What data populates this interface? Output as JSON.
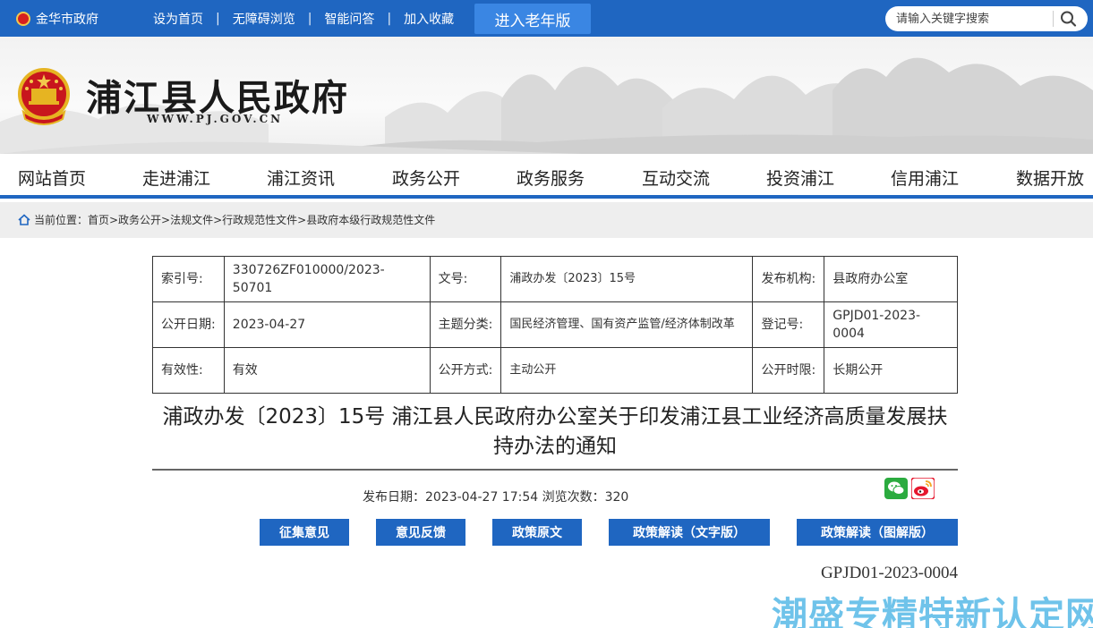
{
  "topbar": {
    "city": "金华市政府",
    "links": [
      "设为首页",
      "无障碍浏览",
      "智能问答",
      "加入收藏"
    ],
    "elder_mode": "进入老年版",
    "search_placeholder": "请输入关键字搜索"
  },
  "banner": {
    "site_name": "浦江县人民政府",
    "site_url": "WWW.PJ.GOV.CN"
  },
  "nav": [
    "网站首页",
    "走进浦江",
    "浦江资讯",
    "政务公开",
    "政务服务",
    "互动交流",
    "投资浦江",
    "信用浦江",
    "数据开放"
  ],
  "breadcrumb": "当前位置：首页>政务公开>法规文件>行政规范性文件>县政府本级行政规范性文件",
  "meta": {
    "index_label": "索引号:",
    "index_value": "330726ZF010000/2023-50701",
    "docno_label": "文号:",
    "docno_value": "浦政办发〔2023〕15号",
    "issuer_label": "发布机构:",
    "issuer_value": "县政府办公室",
    "pubdate_label": "公开日期:",
    "pubdate_value": "2023-04-27",
    "topic_label": "主题分类:",
    "topic_value": "国民经济管理、国有资产监管/经济体制改革",
    "regno_label": "登记号:",
    "regno_value": "GPJD01-2023-0004",
    "valid_label": "有效性:",
    "valid_value": "有效",
    "method_label": "公开方式:",
    "method_value": "主动公开",
    "term_label": "公开时限:",
    "term_value": "长期公开"
  },
  "doc_title": "浦政办发〔2023〕15号 浦江县人民政府办公室关于印发浦江县工业经济高质量发展扶持办法的通知",
  "pub_info": "发布日期：2023-04-27 17:54    浏览次数：320",
  "buttons": [
    "征集意见",
    "意见反馈",
    "政策原文",
    "政策解读（文字版）",
    "政策解读（图解版）"
  ],
  "reg_code": "GPJD01-2023-0004",
  "watermark": "潮盛专精特新认定网",
  "colors": {
    "primary": "#1f66c1",
    "elder_button": "#3a86e3",
    "watermark": "#6fc3ea"
  }
}
